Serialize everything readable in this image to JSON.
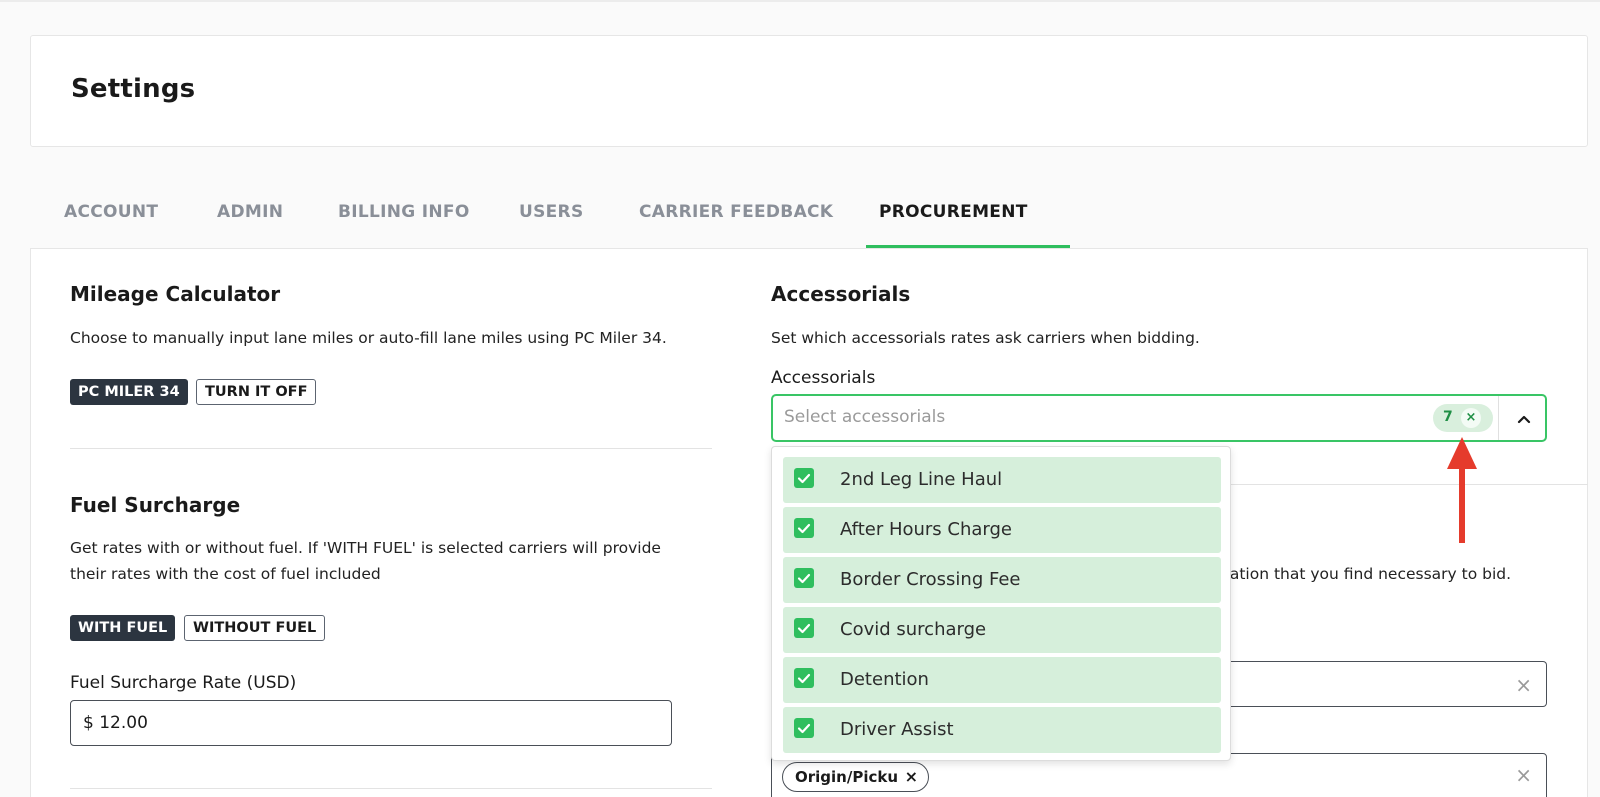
{
  "page": {
    "title": "Settings"
  },
  "tabs": [
    {
      "label": "ACCOUNT",
      "active": false
    },
    {
      "label": "ADMIN",
      "active": false
    },
    {
      "label": "BILLING INFO",
      "active": false
    },
    {
      "label": "USERS",
      "active": false
    },
    {
      "label": "CARRIER FEEDBACK",
      "active": false
    },
    {
      "label": "PROCUREMENT",
      "active": true
    }
  ],
  "mileage": {
    "title": "Mileage Calculator",
    "description": "Choose to manually input lane miles or auto-fill lane miles using PC Miler 34.",
    "option_on": "PC MILER 34",
    "option_off": "TURN IT OFF"
  },
  "fuel": {
    "title": "Fuel Surcharge",
    "description_line1": "Get rates with or without fuel. If 'WITH FUEL' is selected carriers will provide",
    "description_line2": "their rates with the cost of fuel included",
    "option_with": "WITH FUEL",
    "option_without": "WITHOUT FUEL",
    "rate_label": "Fuel Surcharge Rate (USD)",
    "rate_value": "$ 12.00"
  },
  "accessorials": {
    "title": "Accessorials",
    "description": "Set which accessorials rates ask carriers when bidding.",
    "field_label": "Accessorials",
    "placeholder": "Select accessorials",
    "selected_count": "7",
    "clear_glyph": "×",
    "options": [
      {
        "label": "2nd Leg Line Haul",
        "checked": true
      },
      {
        "label": "After Hours Charge",
        "checked": true
      },
      {
        "label": "Border Crossing Fee",
        "checked": true
      },
      {
        "label": "Covid surcharge",
        "checked": true
      },
      {
        "label": "Detention",
        "checked": true
      },
      {
        "label": "Driver Assist",
        "checked": true
      }
    ]
  },
  "behind": {
    "partial_text": "nation that you find necessary to bid.",
    "clear_glyph": "×",
    "tag_label": "Origin/Picku",
    "tag_remove": "×"
  },
  "colors": {
    "accent": "#2fbe5e",
    "dark_button": "#2c3540",
    "chip_bg": "#d9efdd",
    "option_bg": "#d6efdb",
    "annotation_arrow": "#e53b2c"
  }
}
